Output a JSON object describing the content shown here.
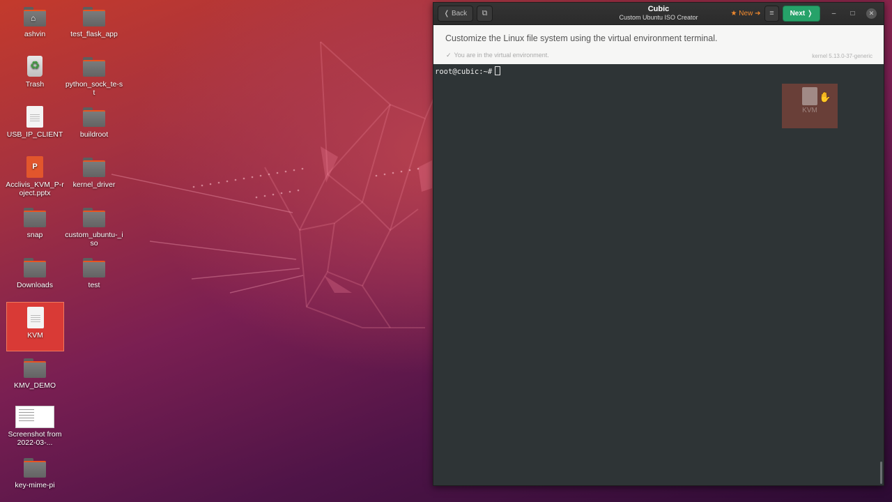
{
  "desktop": {
    "icons": [
      {
        "label": "ashvin",
        "icon": "home-folder-icon"
      },
      {
        "label": "test_flask_app",
        "icon": "folder-icon"
      },
      {
        "label": "Trash",
        "icon": "trash-icon"
      },
      {
        "label": "python_sock_te-st",
        "icon": "folder-icon"
      },
      {
        "label": "USB_IP_CLIENT",
        "icon": "text-file-icon"
      },
      {
        "label": "buildroot",
        "icon": "folder-icon"
      },
      {
        "label": "Acclivis_KVM_P-roject.pptx",
        "icon": "presentation-file-icon"
      },
      {
        "label": "kernel_driver",
        "icon": "folder-icon"
      },
      {
        "label": "snap",
        "icon": "folder-icon"
      },
      {
        "label": "custom_ubuntu-_iso",
        "icon": "folder-icon"
      },
      {
        "label": "Downloads",
        "icon": "folder-icon"
      },
      {
        "label": "test",
        "icon": "folder-icon"
      },
      {
        "label": "KVM",
        "icon": "text-file-icon",
        "selected": true
      },
      {
        "label": "KMV_DEMO",
        "icon": "folder-icon"
      },
      {
        "label": "Screenshot from 2022-03-...",
        "icon": "image-thumbnail-icon"
      },
      {
        "label": "key-mime-pi",
        "icon": "folder-icon"
      }
    ]
  },
  "window": {
    "back_label": "❬ Back",
    "title": "Cubic",
    "subtitle": "Custom Ubuntu ISO Creator",
    "new_label": "★ New ➔",
    "next_label": "Next ❭",
    "instruction": "Customize the Linux file system using the virtual environment terminal.",
    "status": "You are in the virtual environment.",
    "kernel": "kernel 5.13.0-37-generic",
    "terminal_prompt": "root@cubic:~#"
  },
  "drag_ghost": {
    "label": "KVM"
  },
  "colors": {
    "accent_orange": "#e95420",
    "next_green": "#26a269",
    "terminal_bg": "#2e3436"
  }
}
